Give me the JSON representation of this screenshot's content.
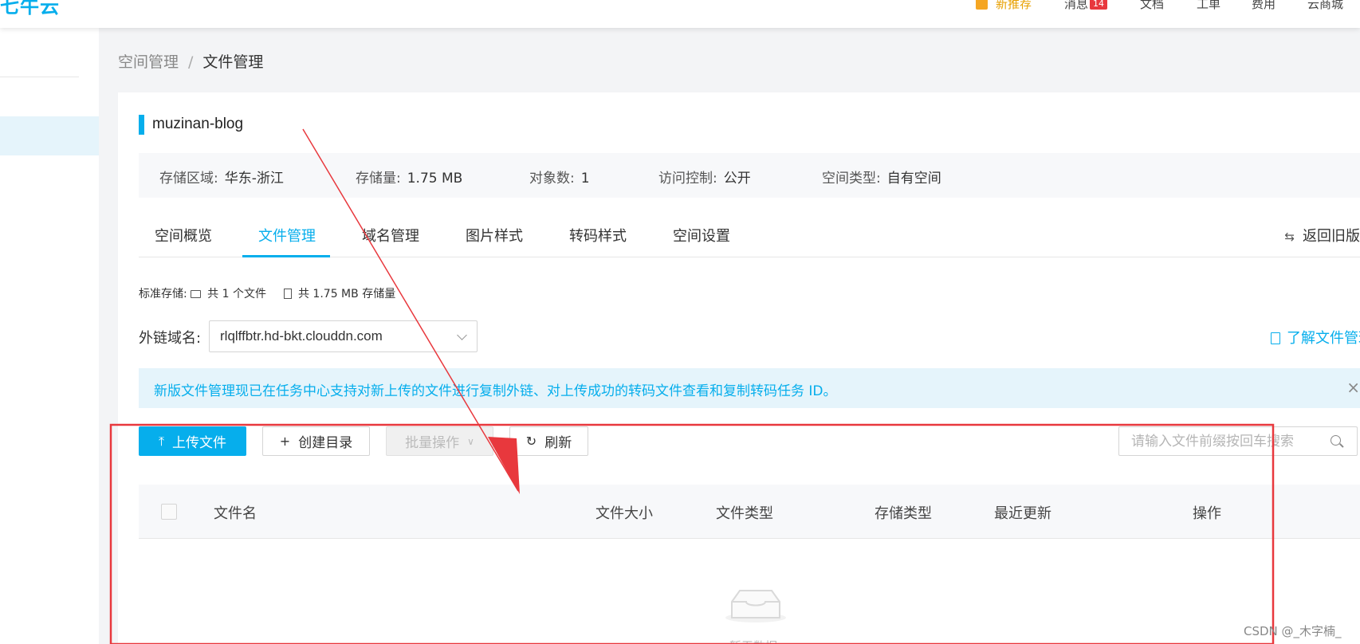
{
  "header": {
    "logo": "七牛云",
    "nav": {
      "promo": "新推荐",
      "messages": "消息",
      "messages_count": "14",
      "docs": "文档",
      "tickets": "工单",
      "billing": "费用",
      "mall": "云商城"
    }
  },
  "breadcrumb": {
    "parent": "空间管理",
    "separator": "/",
    "current": "文件管理"
  },
  "bucket": {
    "name": "muzinan-blog",
    "info": [
      {
        "label": "存储区域:",
        "value": "华东-浙江"
      },
      {
        "label": "存储量:",
        "value": "1.75 MB"
      },
      {
        "label": "对象数:",
        "value": "1"
      },
      {
        "label": "访问控制:",
        "value": "公开"
      },
      {
        "label": "空间类型:",
        "value": "自有空间"
      }
    ]
  },
  "tabs": {
    "items": [
      "空间概览",
      "文件管理",
      "域名管理",
      "图片样式",
      "转码样式",
      "空间设置"
    ],
    "active_index": 1,
    "back_old": "返回旧版"
  },
  "stats": {
    "label": "标准存储:",
    "files": "共 1 个文件",
    "storage": "共 1.75 MB 存储量"
  },
  "domain": {
    "label": "外链域名:",
    "value": "rlqlffbtr.hd-bkt.clouddn.com",
    "learn_link": "了解文件管理"
  },
  "notice": {
    "text": "新版文件管理现已在任务中心支持对新上传的文件进行复制外链、对上传成功的转码文件查看和复制转码任务 ID。",
    "close": "×"
  },
  "toolbar": {
    "upload": "上传文件",
    "mkdir": "创建目录",
    "batch": "批量操作",
    "refresh": "刷新",
    "search_placeholder": "请输入文件前缀按回车搜索"
  },
  "table": {
    "columns": [
      "文件名",
      "文件大小",
      "文件类型",
      "存储类型",
      "最近更新",
      "操作"
    ],
    "empty_text": "暂无数据"
  },
  "watermark": "CSDN @_木字楠_",
  "colors": {
    "brand": "#06aeec",
    "annotation": "#e8383d"
  }
}
